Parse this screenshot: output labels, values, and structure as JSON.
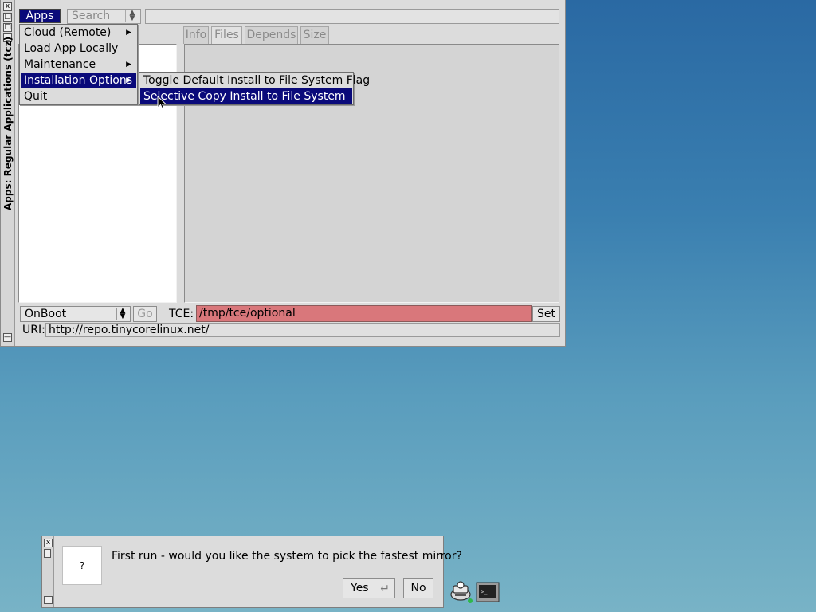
{
  "window": {
    "title": "Apps: Regular Applications (tcz)",
    "wm_buttons": [
      "x",
      "□",
      "□",
      "_"
    ],
    "minimize_glyph": "—"
  },
  "toolbar": {
    "apps_label": "Apps",
    "search_select_value": "Search",
    "search_input_value": ""
  },
  "tabs": [
    {
      "label": "Info"
    },
    {
      "label": "Files"
    },
    {
      "label": "Depends"
    },
    {
      "label": "Size"
    }
  ],
  "apps_menu": {
    "items": [
      {
        "label": "Cloud (Remote)",
        "submenu": true
      },
      {
        "label": "Load App Locally",
        "submenu": false
      },
      {
        "label": "Maintenance",
        "submenu": true
      },
      {
        "label": "Installation Options",
        "submenu": true,
        "selected": true
      },
      {
        "label": "Quit",
        "submenu": false
      }
    ]
  },
  "installation_submenu": {
    "items": [
      {
        "label": "Toggle Default Install to File System Flag"
      },
      {
        "label": "Selective Copy Install to File System",
        "selected": true
      }
    ]
  },
  "bottom": {
    "onboot_value": "OnBoot",
    "go_label": "Go",
    "tce_label": "TCE:",
    "tce_value": "/tmp/tce/optional",
    "set_label": "Set",
    "uri_label": "URI:",
    "uri_value": "http://repo.tinycorelinux.net/"
  },
  "dialog": {
    "close_glyph": "x",
    "icon_text": "?",
    "message": "First run - would you like the system to pick the fastest mirror?",
    "yes_label": "Yes",
    "no_label": "No"
  },
  "colors": {
    "selection": "#0a0a7a",
    "tce_field": "#d9777b",
    "desktop_top": "#2a69a3",
    "desktop_bottom": "#78b3c6"
  },
  "icons": [
    "drive-icon",
    "terminal-icon",
    "question-icon",
    "submenu-arrow-icon",
    "return-icon"
  ]
}
